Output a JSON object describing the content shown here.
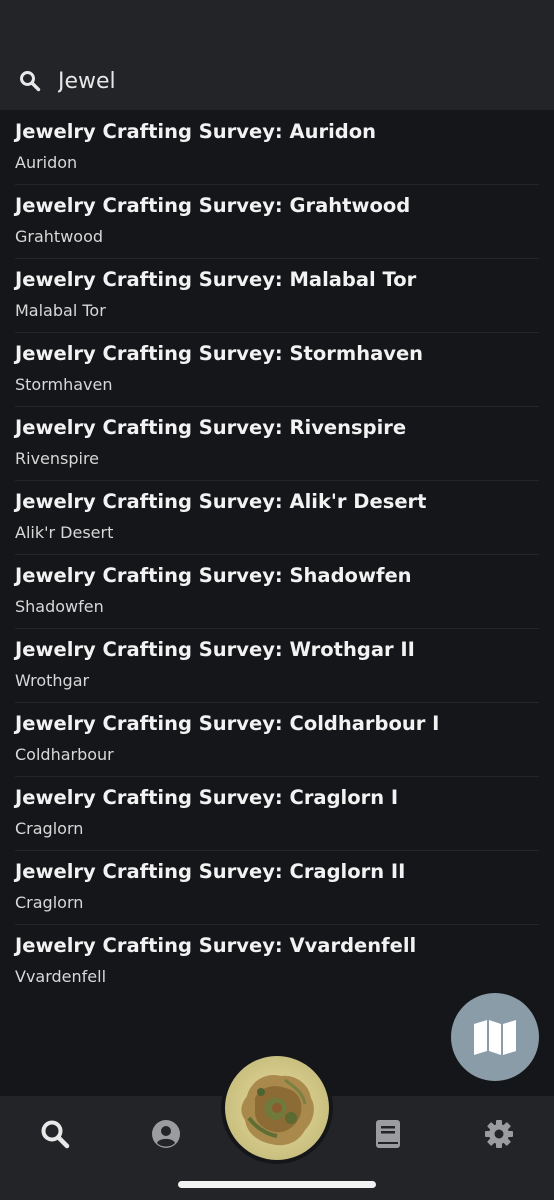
{
  "search": {
    "value": "Jewel",
    "icon": "search-icon"
  },
  "results": [
    {
      "title": "Jewelry Crafting Survey: Auridon",
      "subtitle": "Auridon"
    },
    {
      "title": "Jewelry Crafting Survey: Grahtwood",
      "subtitle": "Grahtwood"
    },
    {
      "title": "Jewelry Crafting Survey: Malabal Tor",
      "subtitle": "Malabal Tor"
    },
    {
      "title": "Jewelry Crafting Survey: Stormhaven",
      "subtitle": "Stormhaven"
    },
    {
      "title": "Jewelry Crafting Survey: Rivenspire",
      "subtitle": "Rivenspire"
    },
    {
      "title": "Jewelry Crafting Survey: Alik'r Desert",
      "subtitle": "Alik'r Desert"
    },
    {
      "title": "Jewelry Crafting Survey: Shadowfen",
      "subtitle": "Shadowfen"
    },
    {
      "title": "Jewelry Crafting Survey: Wrothgar II",
      "subtitle": "Wrothgar"
    },
    {
      "title": "Jewelry Crafting Survey: Coldharbour I",
      "subtitle": "Coldharbour"
    },
    {
      "title": "Jewelry Crafting Survey: Craglorn I",
      "subtitle": "Craglorn"
    },
    {
      "title": "Jewelry Crafting Survey: Craglorn II",
      "subtitle": "Craglorn"
    },
    {
      "title": "Jewelry Crafting Survey: Vvardenfell",
      "subtitle": "Vvardenfell"
    }
  ],
  "tabs": [
    {
      "icon": "search-icon",
      "active": true
    },
    {
      "icon": "person-icon",
      "active": false
    },
    {
      "icon": "world-map-thumbnail",
      "active": false
    },
    {
      "icon": "book-icon",
      "active": false
    },
    {
      "icon": "gear-icon",
      "active": false
    }
  ],
  "fab": {
    "icon": "map-icon"
  },
  "colors": {
    "background": "#151619",
    "header": "#232428",
    "fab": "#8a9ca8",
    "active_icon": "#e8e8e8",
    "inactive_icon": "#9a9ca0"
  }
}
